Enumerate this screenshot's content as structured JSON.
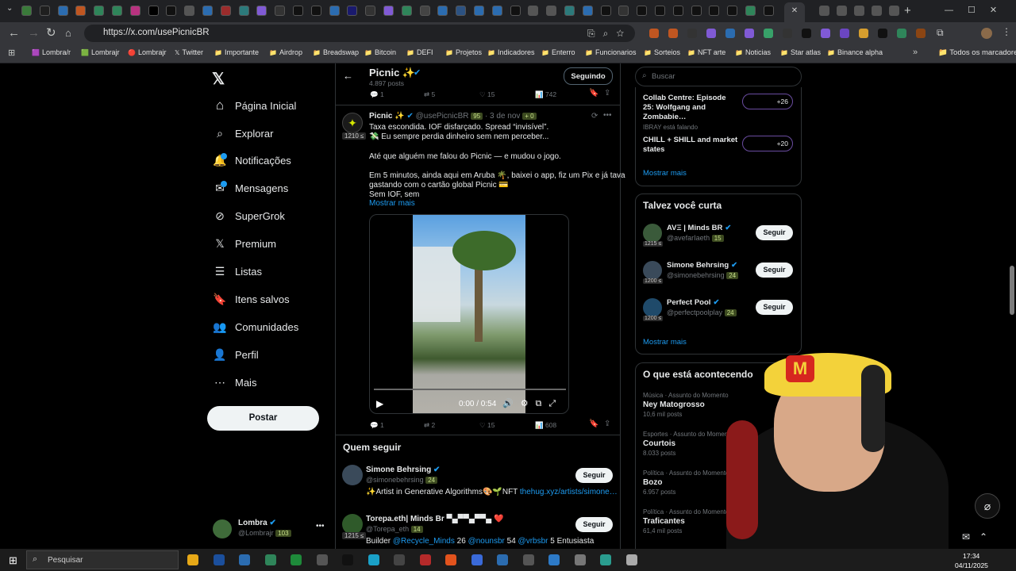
{
  "browser": {
    "url": "https://x.com/usePicnicBR",
    "bookmarks": [
      "Lombra/r",
      "Lombrajr",
      "Lombrajr",
      "Twitter",
      "Importante",
      "Airdrop",
      "Breadswap",
      "Bitcoin",
      "DEFI",
      "Projetos",
      "Indicadores",
      "Enterro",
      "Funcionarios",
      "Sorteios",
      "NFT arte",
      "Noticias",
      "Star atlas",
      "Binance alpha"
    ],
    "other_bookmarks": "Todos os marcadores"
  },
  "nav": {
    "items": [
      "Página Inicial",
      "Explorar",
      "Notificações",
      "Mensagens",
      "SuperGrok",
      "Premium",
      "Listas",
      "Itens salvos",
      "Comunidades",
      "Perfil",
      "Mais"
    ],
    "icons": [
      "home-icon",
      "search-icon",
      "bell-icon",
      "mail-icon",
      "grok-icon",
      "x-logo-icon",
      "list-icon",
      "bookmark-icon",
      "communities-icon",
      "person-icon",
      "more-icon"
    ],
    "post_button": "Postar",
    "account_name": "Lombra",
    "account_handle": "@Lombrajr",
    "account_score": "103"
  },
  "profile_header": {
    "name": "Picnic ✨",
    "posts": "4.897 posts",
    "following_button": "Seguindo"
  },
  "prev_tweet_stats": {
    "replies": "1",
    "retweets": "5",
    "likes": "15",
    "views": "742"
  },
  "tweet": {
    "name": "Picnic ✨",
    "handle": "@usePicnicBR",
    "score": "95",
    "date": "· 3 de nov",
    "extra": "0",
    "avatar_score": "1210",
    "lines": [
      "Taxa escondida. IOF disfarçado. Spread “invisível”.",
      "💸 Eu sempre perdia dinheiro sem nem perceber...",
      "",
      "Até que alguém me falou do Picnic — e mudou o jogo.",
      "",
      "Em 5 minutos, ainda aqui em Aruba 🌴, baixei o app, fiz um Pix e já tava",
      "gastando com o cartão global Picnic 💳",
      "Sem IOF, sem"
    ],
    "show_more": "Mostrar mais",
    "video_time": "0:00 / 0:54",
    "stats": {
      "replies": "1",
      "retweets": "2",
      "likes": "15",
      "views": "608"
    }
  },
  "who_to_follow": {
    "title": "Quem seguir",
    "users": [
      {
        "name": "Simone Behrsing",
        "handle": "@simonebehrsing",
        "score": "24",
        "bio": "✨Artist in Generative Algorithms🎨🌱NFT ",
        "bio_link": "thehug.xyz/artists/simone…",
        "button": "Seguir"
      },
      {
        "name": "Torepa.eth| Minds Br ▀▄▀▀▄▀▀▄ ❤️",
        "handle": "@Torepa_eth",
        "score": "14",
        "bio_prefix": "Builder ",
        "bio_link1": "@Recycle_Minds",
        "bio_mid": " 26 ",
        "bio_link2": "@nounsbr",
        "bio_mid2": " 54 ",
        "bio_link3": "@vrbsbr",
        "bio_end": " 5 Entusiasta",
        "avatar_score": "1215",
        "button": "Seguir"
      }
    ]
  },
  "right": {
    "search_placeholder": "Buscar",
    "spaces": [
      {
        "title": "Collab Centre: Episode 25: Wolfgang and Zombabie…",
        "count": "+26"
      },
      {
        "host": "IBRAY está falando",
        "title": "CHILL + SHILL and market states",
        "count": "+20"
      }
    ],
    "show_more": "Mostrar mais",
    "suggest_title": "Talvez você curta",
    "suggest": [
      {
        "name": "AVΞ | Minds BR",
        "handle": "@avefarIaeth",
        "score": "15",
        "avatar_score": "1215",
        "button": "Seguir"
      },
      {
        "name": "Simone Behrsing",
        "handle": "@simonebehrsing",
        "score": "24",
        "avatar_score": "1200",
        "button": "Seguir"
      },
      {
        "name": "Perfect Pool",
        "handle": "@perfectpoolplay",
        "score": "24",
        "avatar_score": "1200",
        "button": "Seguir"
      }
    ],
    "suggest_more": "Mostrar mais",
    "trends_title": "O que está acontecendo",
    "trends": [
      {
        "cat": "Música · Assunto do Momento",
        "name": "Ney Matogrosso",
        "count": "10,6 mil posts"
      },
      {
        "cat": "Esportes · Assunto do Momento",
        "name": "Courtois",
        "count": "8.033 posts"
      },
      {
        "cat": "Política · Assunto do Momento",
        "name": "Bozo",
        "count": "6.957 posts"
      },
      {
        "cat": "Política · Assunto do Momento",
        "name": "Traficantes",
        "count": "61,4 mil posts"
      }
    ]
  },
  "taskbar": {
    "search": "Pesquisar",
    "time": "17:34",
    "date": "04/11/2025"
  }
}
